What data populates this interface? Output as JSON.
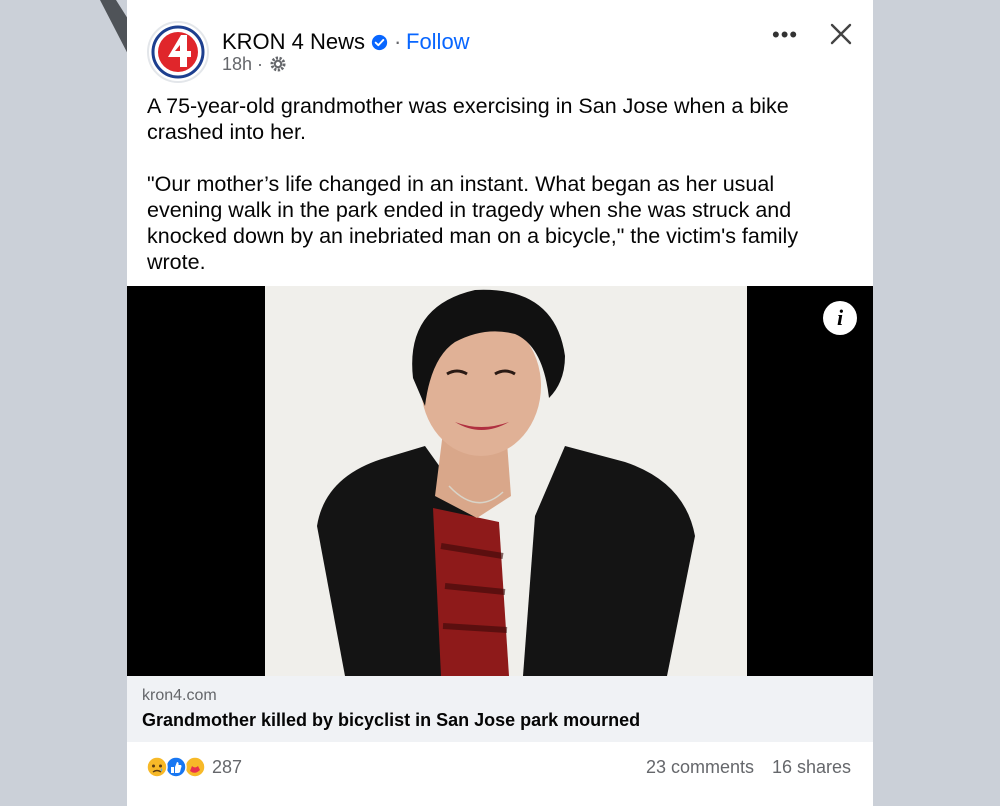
{
  "post": {
    "page_name": "KRON 4 News",
    "follow_label": "Follow",
    "dot": "·",
    "time": "18h ·",
    "more_label": "•••",
    "paragraphs": [
      "A 75-year-old grandmother was exercising in San Jose when a bike crashed into her.",
      "\"Our mother’s life changed in an instant. What began as her usual evening walk in the park ended in tragedy when she was struck and knocked down by an inebriated man on a bicycle,\" the victim's family wrote."
    ]
  },
  "media": {
    "info_label": "i"
  },
  "link": {
    "domain": "kron4.com",
    "title": "Grandmother killed by bicyclist in San Jose park mourned"
  },
  "stats": {
    "reaction_count": "287",
    "comments": "23 comments",
    "shares": "16 shares"
  },
  "icons": [
    "kron4-logo-icon",
    "verified-badge-icon",
    "gear-icon",
    "close-icon",
    "info-icon",
    "sad-reaction-icon",
    "like-reaction-icon",
    "care-reaction-icon"
  ],
  "colors": {
    "follow": "#0866ff",
    "muted": "#65676b",
    "logo_red": "#e0262b"
  }
}
